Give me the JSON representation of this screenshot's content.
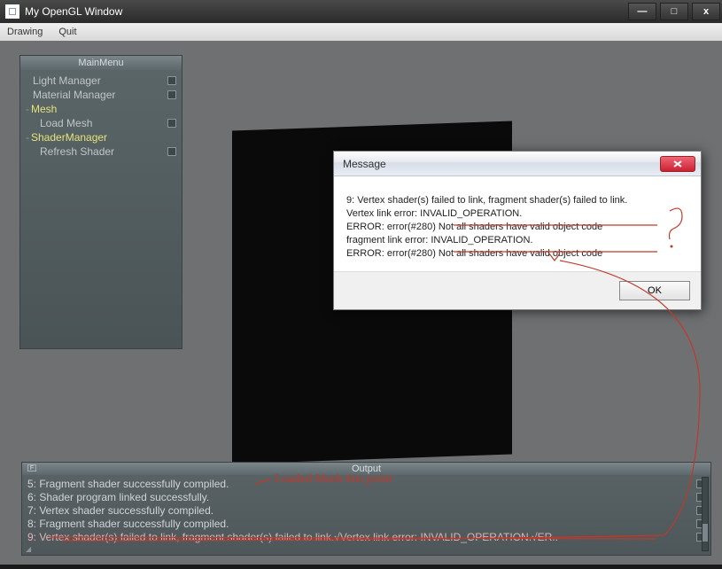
{
  "window": {
    "title": "My OpenGL Window",
    "buttons": {
      "min": "—",
      "max": "□",
      "close": "x"
    }
  },
  "menubar": {
    "items": [
      "Drawing",
      "Quit"
    ]
  },
  "mainmenu": {
    "title": "MainMenu",
    "items": [
      {
        "label": "Light Manager",
        "type": "plain",
        "checkbox": true
      },
      {
        "label": "Material Manager",
        "type": "plain",
        "checkbox": true
      },
      {
        "label": "Mesh",
        "type": "group",
        "checkbox": false
      },
      {
        "label": "Load Mesh",
        "type": "child",
        "checkbox": true
      },
      {
        "label": "ShaderManager",
        "type": "group",
        "checkbox": false
      },
      {
        "label": "Refresh Shader",
        "type": "child",
        "checkbox": true
      }
    ]
  },
  "dialog": {
    "title": "Message",
    "lines": [
      "9: Vertex shader(s) failed to link, fragment shader(s) failed to link.",
      "Vertex link error: INVALID_OPERATION.",
      "ERROR: error(#280) Not all shaders have valid object code",
      "fragment link error: INVALID_OPERATION.",
      "ERROR: error(#280) Not all shaders have valid object code"
    ],
    "ok_label": "OK"
  },
  "output": {
    "title": "Output",
    "lines": [
      {
        "text": "5: Fragment shader successfully compiled.",
        "err": false
      },
      {
        "text": "6: Shader program linked successfully.",
        "err": false
      },
      {
        "text": "7: Vertex shader successfully compiled.",
        "err": false
      },
      {
        "text": "8: Fragment shader successfully compiled.",
        "err": false
      },
      {
        "text": "9: Vertex shader(s) failed to link, fragment shader(s) failed to link.√Vertex link error: INVALID_OPERATION.√ER..",
        "err": true
      }
    ]
  },
  "annotations": {
    "question": "?",
    "loaded_mesh": "Loaded Mesh this point"
  }
}
